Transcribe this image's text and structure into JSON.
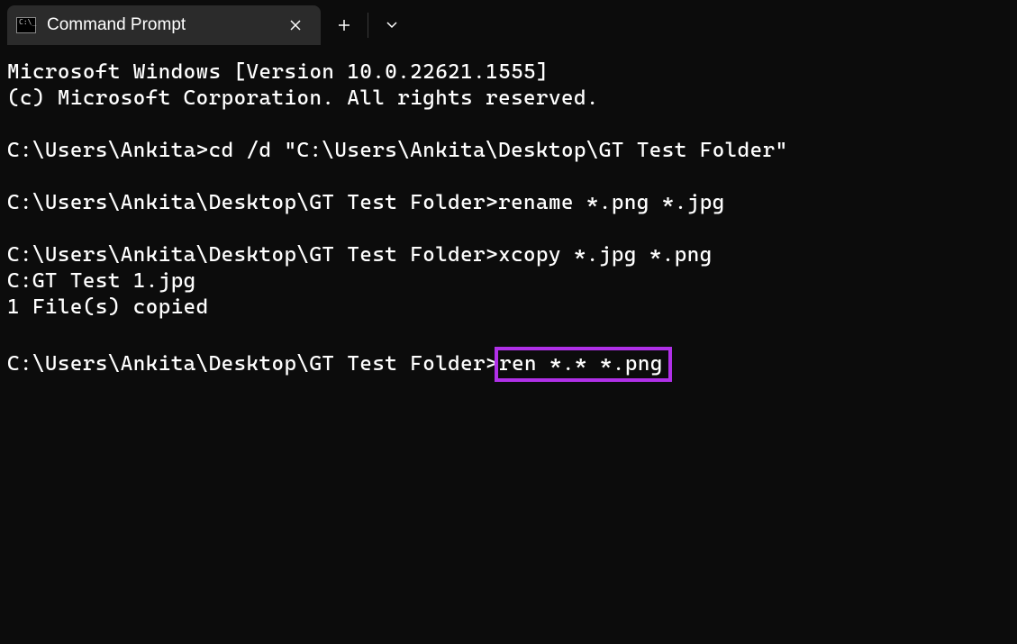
{
  "titlebar": {
    "tab_title": "Command Prompt"
  },
  "terminal": {
    "line1": "Microsoft Windows [Version 10.0.22621.1555]",
    "line2": "(c) Microsoft Corporation. All rights reserved.",
    "blank1": "",
    "prompt1": "C:\\Users\\Ankita>",
    "cmd1": "cd /d \"C:\\Users\\Ankita\\Desktop\\GT Test Folder\"",
    "blank2": "",
    "prompt2": "C:\\Users\\Ankita\\Desktop\\GT Test Folder>",
    "cmd2": "rename *.png *.jpg",
    "blank3": "",
    "prompt3": "C:\\Users\\Ankita\\Desktop\\GT Test Folder>",
    "cmd3": "xcopy *.jpg *.png",
    "out1": "C:GT Test 1.jpg",
    "out2": "1 File(s) copied",
    "blank4": "",
    "prompt4": "C:\\Users\\Ankita\\Desktop\\GT Test Folder>",
    "cmd4": "ren *.* *.png"
  }
}
